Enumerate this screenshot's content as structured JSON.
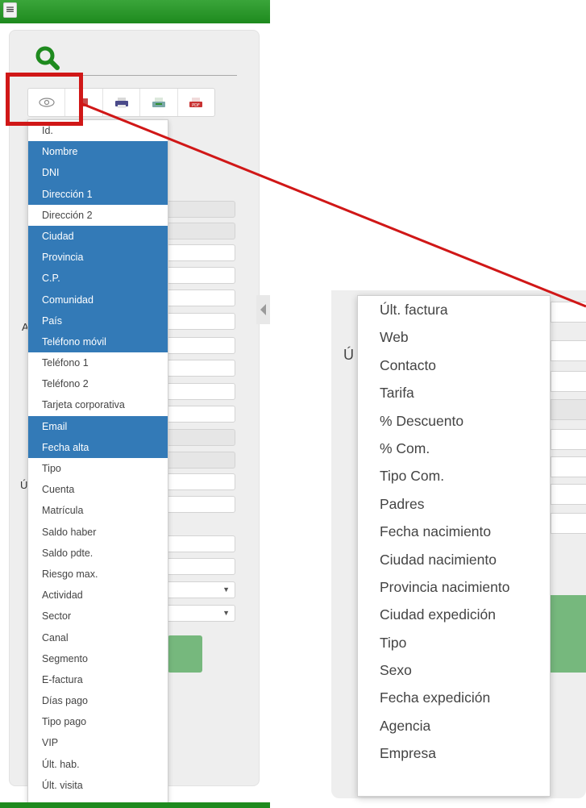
{
  "app": {
    "menu_icon": "hamburger-icon",
    "accent_color": "#2e9a2e",
    "selection_color": "#337ab7",
    "highlight_color": "#d01717"
  },
  "toolbar": {
    "buttons": [
      {
        "name": "eye-icon"
      },
      {
        "name": "arrow-icon"
      },
      {
        "name": "printer-icon"
      },
      {
        "name": "export-sheet-icon"
      },
      {
        "name": "pdf-icon",
        "label": "PDF"
      }
    ]
  },
  "columns_dropdown": {
    "items": [
      {
        "label": "Id.",
        "selected": false
      },
      {
        "label": "Nombre",
        "selected": true
      },
      {
        "label": "DNI",
        "selected": true
      },
      {
        "label": "Dirección 1",
        "selected": true
      },
      {
        "label": "Dirección 2",
        "selected": false
      },
      {
        "label": "Ciudad",
        "selected": true
      },
      {
        "label": "Provincia",
        "selected": true
      },
      {
        "label": "C.P.",
        "selected": true
      },
      {
        "label": "Comunidad",
        "selected": true
      },
      {
        "label": "País",
        "selected": true
      },
      {
        "label": "Teléfono móvil",
        "selected": true
      },
      {
        "label": "Teléfono 1",
        "selected": false
      },
      {
        "label": "Teléfono 2",
        "selected": false
      },
      {
        "label": "Tarjeta corporativa",
        "selected": false
      },
      {
        "label": "Email",
        "selected": true
      },
      {
        "label": "Fecha alta",
        "selected": true
      },
      {
        "label": "Tipo",
        "selected": false
      },
      {
        "label": "Cuenta",
        "selected": false
      },
      {
        "label": "Matrícula",
        "selected": false
      },
      {
        "label": "Saldo haber",
        "selected": false
      },
      {
        "label": "Saldo pdte.",
        "selected": false
      },
      {
        "label": "Riesgo max.",
        "selected": false
      },
      {
        "label": "Actividad",
        "selected": false
      },
      {
        "label": "Sector",
        "selected": false
      },
      {
        "label": "Canal",
        "selected": false
      },
      {
        "label": "Segmento",
        "selected": false
      },
      {
        "label": "E-factura",
        "selected": false
      },
      {
        "label": "Días pago",
        "selected": false
      },
      {
        "label": "Tipo pago",
        "selected": false
      },
      {
        "label": "VIP",
        "selected": false
      },
      {
        "label": "Últ. hab.",
        "selected": false
      },
      {
        "label": "Últ. visita",
        "selected": false
      }
    ]
  },
  "zoomed_dropdown": {
    "items": [
      "Últ. factura",
      "Web",
      "Contacto",
      "Tarifa",
      "% Descuento",
      "% Com.",
      "Tipo Com.",
      "Padres",
      "Fecha nacimiento",
      "Ciudad nacimiento",
      "Provincia nacimiento",
      "Ciudad expedición",
      "Tipo",
      "Sexo",
      "Fecha expedición",
      "Agencia",
      "Empresa"
    ]
  },
  "background_labels": {
    "label_a": "A",
    "label_u": "Ú",
    "zoom_label_u": "Ú"
  }
}
